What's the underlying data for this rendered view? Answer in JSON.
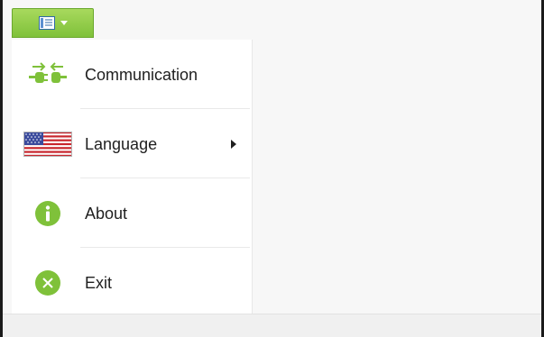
{
  "menu": {
    "items": [
      {
        "label": "Communication",
        "icon": "plug-connect-icon"
      },
      {
        "label": "Language",
        "icon": "us-flag-icon",
        "has_submenu": true
      },
      {
        "label": "About",
        "icon": "info-icon"
      },
      {
        "label": "Exit",
        "icon": "close-circle-icon"
      }
    ]
  },
  "colors": {
    "accent_green": "#7fc13a",
    "menu_button_top": "#a8d95d"
  }
}
